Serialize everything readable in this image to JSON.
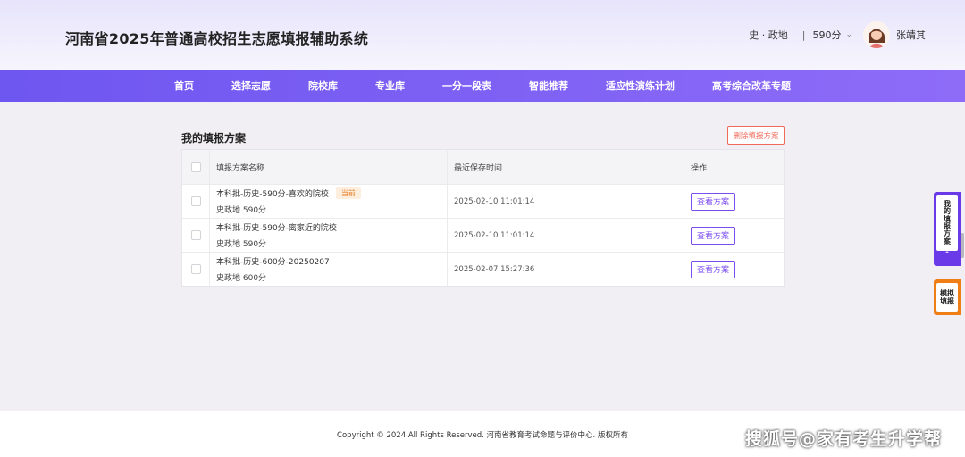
{
  "header": {
    "title": "河南省2025年普通高校招生志愿填报辅助系统",
    "subjects": "史 · 政地",
    "separator": "|",
    "score": "590分",
    "username": "张靖其"
  },
  "nav": {
    "items": [
      "首页",
      "选择志愿",
      "院校库",
      "专业库",
      "一分一段表",
      "智能推荐",
      "适应性演练计划",
      "高考综合改革专题"
    ]
  },
  "main": {
    "section_title": "我的填报方案",
    "delete_button": "删除填报方案",
    "columns": [
      "",
      "填报方案名称",
      "最近保存时间",
      "操作"
    ],
    "rows": [
      {
        "name": "本科批-历史-590分-喜欢的院校",
        "badge": "当前",
        "sub": "史政地 590分",
        "time": "2025-02-10 11:01:14",
        "action": "查看方案"
      },
      {
        "name": "本科批-历史-590分-离家近的院校",
        "badge": "",
        "sub": "史政地 590分",
        "time": "2025-02-10 11:01:14",
        "action": "查看方案"
      },
      {
        "name": "本科批-历史-600分-20250207",
        "badge": "",
        "sub": "史政地 600分",
        "time": "2025-02-07 15:27:36",
        "action": "查看方案"
      }
    ]
  },
  "float": {
    "my_plan": "我的填报方案",
    "arrow": "^",
    "simulate": "模拟填报"
  },
  "footer": {
    "copyright": "Copyright © 2024 All Rights Reserved. 河南省教育考试命题与评价中心. 版权所有",
    "watermark": "搜狐号@家有考生升学帮"
  },
  "colors": {
    "nav_gradient_start": "#6e56f0",
    "nav_gradient_end": "#8e6cf8",
    "accent_purple": "#7b4cf0",
    "danger_red": "#f06a5a",
    "badge_orange": "#e8832c",
    "float_orange": "#f07e17"
  }
}
